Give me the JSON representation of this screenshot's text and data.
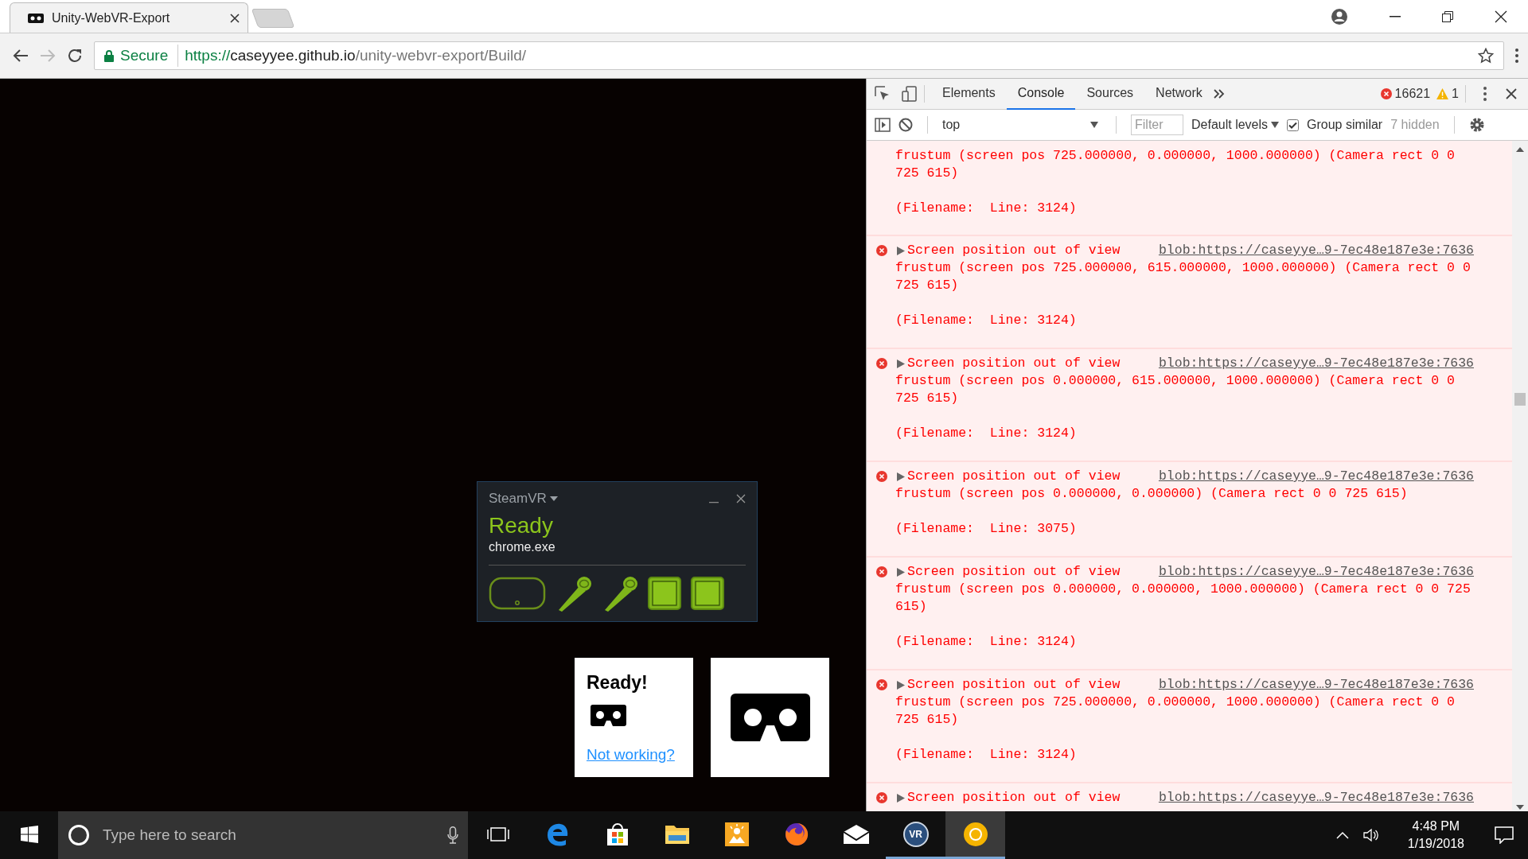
{
  "browser": {
    "tab": {
      "title": "Unity-WebVR-Export"
    },
    "address": {
      "security": "Secure",
      "scheme": "https://",
      "host": "caseyyee.github.io",
      "path": "/unity-webvr-export/Build/"
    },
    "forward_disabled": true
  },
  "page": {
    "steamvr": {
      "title": "SteamVR",
      "status": "Ready",
      "app": "chrome.exe",
      "devices": [
        {
          "kind": "headset"
        },
        {
          "kind": "controller"
        },
        {
          "kind": "controller"
        },
        {
          "kind": "base-station"
        },
        {
          "kind": "base-station"
        }
      ]
    },
    "vr_panel": {
      "status": "Ready!",
      "help_link": "Not working?"
    }
  },
  "devtools": {
    "tabs": [
      {
        "label": "Elements",
        "selected": false
      },
      {
        "label": "Console",
        "selected": true
      },
      {
        "label": "Sources",
        "selected": false
      },
      {
        "label": "Network",
        "selected": false
      }
    ],
    "errors": "16621",
    "warnings": "1",
    "context": "top",
    "filter": {
      "placeholder": "Filter"
    },
    "levels": "Default levels",
    "group_similar": {
      "label": "Group similar",
      "checked": true
    },
    "hidden": "7 hidden",
    "messages": [
      {
        "kind": "continued",
        "body": "frustum (screen pos 725.000000, 0.000000, 1000.000000) (Camera rect 0 0 725 615)",
        "filename": "(Filename:  Line: 3124)"
      },
      {
        "kind": "full",
        "head": "Screen position out of view",
        "source": "blob:https://caseyye…9-7ec48e187e3e:7636",
        "body": "frustum (screen pos 725.000000, 615.000000, 1000.000000) (Camera rect 0 0 725 615)",
        "filename": "(Filename:  Line: 3124)"
      },
      {
        "kind": "full",
        "head": "Screen position out of view",
        "source": "blob:https://caseyye…9-7ec48e187e3e:7636",
        "body": "frustum (screen pos 0.000000, 615.000000, 1000.000000) (Camera rect 0 0 725 615)",
        "filename": "(Filename:  Line: 3124)"
      },
      {
        "kind": "full",
        "head": "Screen position out of view",
        "source": "blob:https://caseyye…9-7ec48e187e3e:7636",
        "body": "frustum (screen pos 0.000000, 0.000000) (Camera rect 0 0 725 615)",
        "filename": "(Filename:  Line: 3075)"
      },
      {
        "kind": "full",
        "head": "Screen position out of view",
        "source": "blob:https://caseyye…9-7ec48e187e3e:7636",
        "body": "frustum (screen pos 0.000000, 0.000000, 1000.000000) (Camera rect 0 0 725 615)",
        "filename": "(Filename:  Line: 3124)"
      },
      {
        "kind": "full",
        "head": "Screen position out of view",
        "source": "blob:https://caseyye…9-7ec48e187e3e:7636",
        "body": "frustum (screen pos 725.000000, 0.000000, 1000.000000) (Camera rect 0 0 725 615)",
        "filename": "(Filename:  Line: 3124)"
      },
      {
        "kind": "head-only",
        "head": "Screen position out of view",
        "source": "blob:https://caseyye…9-7ec48e187e3e:7636"
      }
    ]
  },
  "taskbar": {
    "search": {
      "placeholder": "Type here to search"
    },
    "apps": [
      {
        "kind": "task-view",
        "running": false,
        "selected": false
      },
      {
        "kind": "edge",
        "running": false,
        "selected": false
      },
      {
        "kind": "store",
        "running": false,
        "selected": false
      },
      {
        "kind": "explorer",
        "running": false,
        "selected": false
      },
      {
        "kind": "paint",
        "running": false,
        "selected": false
      },
      {
        "kind": "firefox",
        "running": false,
        "selected": false
      },
      {
        "kind": "mail",
        "running": false,
        "selected": false
      },
      {
        "kind": "vr",
        "label": "VR",
        "running": true,
        "selected": false
      },
      {
        "kind": "chrome",
        "running": true,
        "selected": true
      }
    ],
    "time": "4:48 PM",
    "date": "1/19/2018"
  }
}
